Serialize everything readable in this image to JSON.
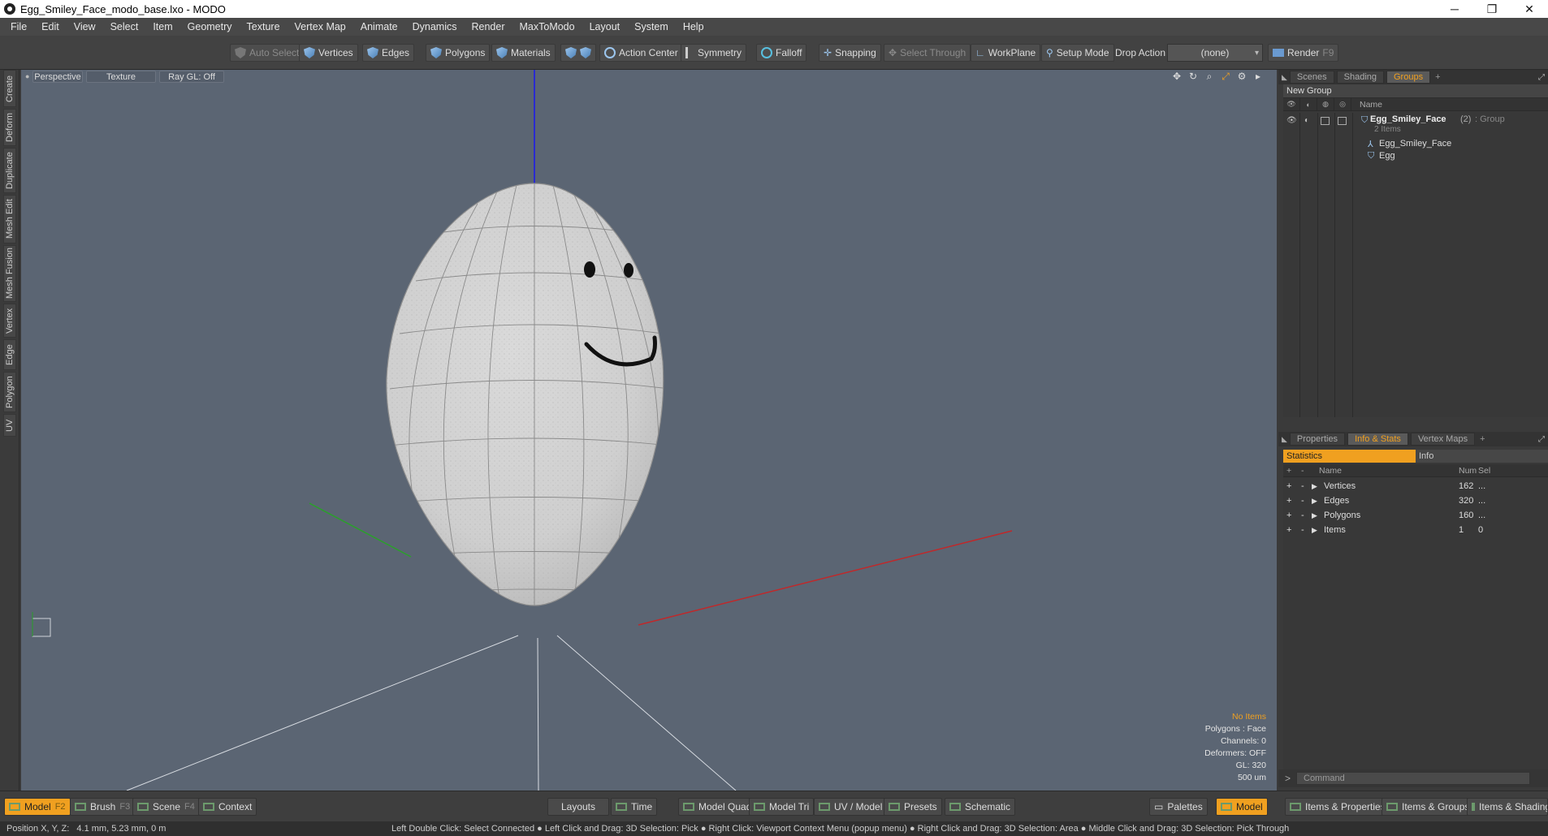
{
  "window": {
    "title": "Egg_Smiley_Face_modo_base.lxo - MODO"
  },
  "menu": [
    "File",
    "Edit",
    "View",
    "Select",
    "Item",
    "Geometry",
    "Texture",
    "Vertex Map",
    "Animate",
    "Dynamics",
    "Render",
    "MaxToModo",
    "Layout",
    "System",
    "Help"
  ],
  "toolbar": {
    "auto_select": "Auto Select",
    "vertices": "Vertices",
    "edges": "Edges",
    "polygons": "Polygons",
    "materials": "Materials",
    "action_center": "Action Center",
    "symmetry": "Symmetry",
    "falloff": "Falloff",
    "snapping": "Snapping",
    "select_through": "Select Through",
    "workplane": "WorkPlane",
    "setup_mode": "Setup Mode",
    "drop_action": "Drop Action",
    "drop_value": "(none)",
    "render": "Render",
    "render_key": "F9"
  },
  "left_tabs": [
    "Create",
    "Deform",
    "Duplicate",
    "Mesh Edit",
    "Mesh Fusion",
    "Vertex",
    "Edge",
    "Polygon",
    "UV"
  ],
  "viewport": {
    "view": "Perspective",
    "shading": "Texture",
    "raygl": "Ray GL: Off",
    "info": {
      "no_items": "No Items",
      "polygons": "Polygons : Face",
      "channels": "Channels: 0",
      "deformers": "Deformers: OFF",
      "gl": "GL: 320",
      "scale": "500 um"
    }
  },
  "groups_panel": {
    "tabs": [
      "Scenes",
      "Shading",
      "Groups"
    ],
    "new_group": "New Group",
    "name_col": "Name",
    "group_name": "Egg_Smiley_Face",
    "group_count": "(2)",
    "group_type": ": Group",
    "group_items": "2 Items",
    "child1": "Egg_Smiley_Face",
    "child2": "Egg"
  },
  "stats_panel": {
    "tabs": [
      "Properties",
      "Info & Stats",
      "Vertex Maps"
    ],
    "statistics": "Statistics",
    "info": "Info",
    "cols": {
      "name": "Name",
      "num": "Num",
      "sel": "Sel"
    },
    "rows": [
      {
        "name": "Vertices",
        "num": "162",
        "sel": "..."
      },
      {
        "name": "Edges",
        "num": "320",
        "sel": "..."
      },
      {
        "name": "Polygons",
        "num": "160",
        "sel": "..."
      },
      {
        "name": "Items",
        "num": "1",
        "sel": "0"
      }
    ],
    "command_placeholder": "Command"
  },
  "bottom": {
    "model": "Model",
    "model_key": "F2",
    "brush": "Brush",
    "brush_key": "F3",
    "scene": "Scene",
    "scene_key": "F4",
    "context": "Context",
    "layouts": "Layouts",
    "time": "Time",
    "model_quad": "Model Quad",
    "model_tri": "Model Tri",
    "uv_model": "UV / Model",
    "presets": "Presets",
    "schematic": "Schematic",
    "palettes": "Palettes",
    "model2": "Model",
    "items_props": "Items & Properties",
    "items_groups": "Items & Groups",
    "items_shading": "Items & Shading"
  },
  "status": {
    "position": "Position X, Y, Z:   4.1 mm, 5.23 mm, 0 m",
    "hints": "Left Double Click: Select Connected ● Left Click and Drag: 3D Selection: Pick ● Right Click: Viewport Context Menu (popup menu) ● Right Click and Drag: 3D Selection: Area ● Middle Click and Drag: 3D Selection: Pick Through"
  },
  "colors": {
    "accent": "#f0a020",
    "viewport_bg": "#5b6573",
    "axis_x": "#c0282a",
    "axis_y": "#2aa02a",
    "axis_z": "#2a2ad0"
  }
}
